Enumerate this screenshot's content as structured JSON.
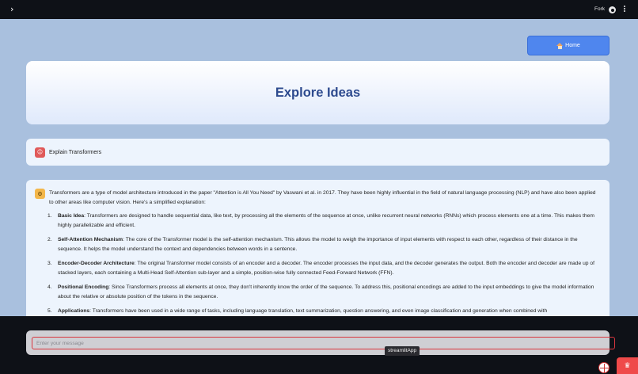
{
  "topbar": {
    "sidebar_toggle_glyph": "›",
    "fork_label": "Fork",
    "github_icon": "github-icon",
    "menu_icon": "more-vertical-icon"
  },
  "home_button": {
    "label": "Home",
    "icon": "home-icon"
  },
  "hero": {
    "title": "Explore Ideas"
  },
  "user_message": {
    "avatar_icon": "user-avatar-icon",
    "text": "Explain Transformers"
  },
  "assistant_message": {
    "avatar_icon": "bot-avatar-icon",
    "intro": "Transformers are a type of model architecture introduced in the paper \"Attention is All You Need\" by Vaswani et al. in 2017. They have been highly influential in the field of natural language processing (NLP) and have also been applied to other areas like computer vision. Here's a simplified explanation:",
    "items": [
      {
        "num": "1.",
        "term": "Basic Idea",
        "text": ": Transformers are designed to handle sequential data, like text, by processing all the elements of the sequence at once, unlike recurrent neural networks (RNNs) which process elements one at a time. This makes them highly parallelizable and efficient."
      },
      {
        "num": "2.",
        "term": "Self-Attention Mechanism",
        "text": ": The core of the Transformer model is the self-attention mechanism. This allows the model to weigh the importance of input elements with respect to each other, regardless of their distance in the sequence. It helps the model understand the context and dependencies between words in a sentence."
      },
      {
        "num": "3.",
        "term": "Encoder-Decoder Architecture",
        "text": ": The original Transformer model consists of an encoder and a decoder. The encoder processes the input data, and the decoder generates the output. Both the encoder and decoder are made up of stacked layers, each containing a Multi-Head Self-Attention sub-layer and a simple, position-wise fully connected Feed-Forward Network (FFN)."
      },
      {
        "num": "4.",
        "term": "Positional Encoding",
        "text": ": Since Transformers process all elements at once, they don't inherently know the order of the sequence. To address this, positional encodings are added to the input embeddings to give the model information about the relative or absolute position of the tokens in the sequence."
      },
      {
        "num": "5.",
        "term": "Applications",
        "text": ": Transformers have been used in a wide range of tasks, including language translation, text summarization, question answering, and even image classification and generation when combined with"
      }
    ]
  },
  "chat_input": {
    "placeholder": "Enter your message",
    "value": ""
  },
  "tooltip": {
    "text": "streamlitApp"
  },
  "footer": {
    "badge_icon": "streamlit-badge-icon",
    "crown_icon": "crown-icon",
    "crown_glyph": "♛"
  }
}
